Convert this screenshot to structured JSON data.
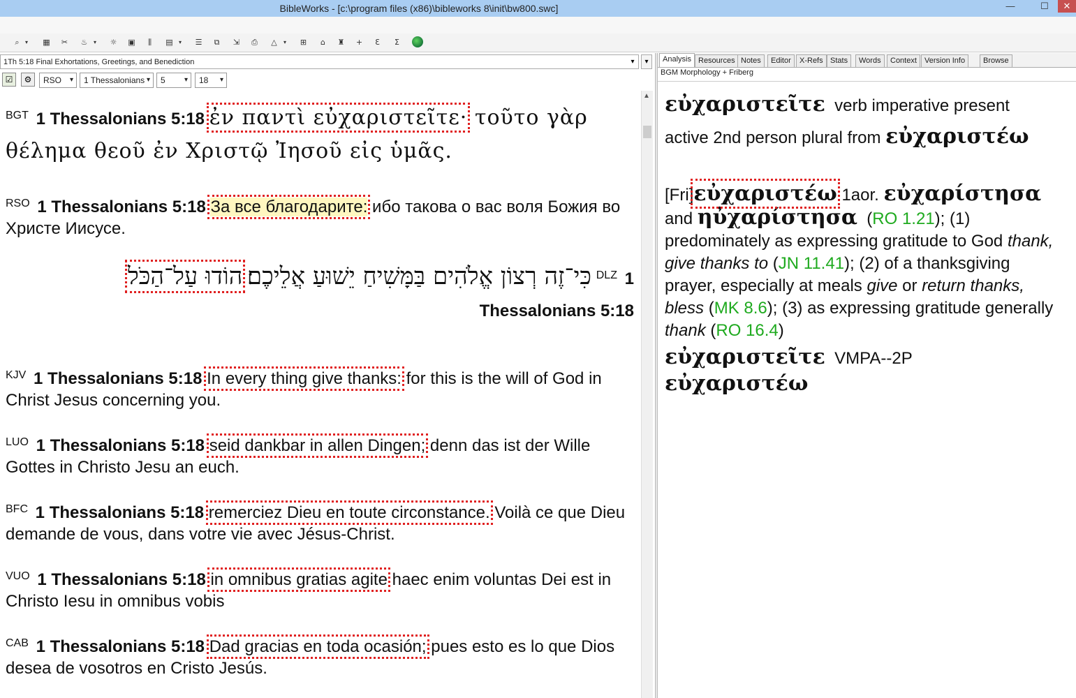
{
  "window": {
    "title": "BibleWorks - [c:\\program files (x86)\\bibleworks 8\\init\\bw800.swc]",
    "minimize": "—",
    "maximize": "☐",
    "close": "✕"
  },
  "toolbar": {
    "icons": [
      "search-icon",
      "search-options-icon",
      "bookmark-icon",
      "tools-icon",
      "lexicon-icon",
      "notes-icon",
      "window-icon",
      "parallel-icon",
      "grid-icon",
      "list-icon",
      "copy-icon",
      "export-icon",
      "print-icon",
      "highlight-icon",
      "layout-icon",
      "form-icon",
      "sort-icon",
      "plus-icon",
      "version-icon",
      "word-icon",
      "globe-icon"
    ]
  },
  "left": {
    "passage": "1Th 5:18 Final Exhortations, Greetings, and Benediction",
    "version_select": "RSO",
    "book_select": "1 Thessalonians",
    "chapter_select": "5",
    "verse_select": "18",
    "verses": [
      {
        "label": "BGT",
        "ref": "1 Thessalonians 5:18",
        "highlight": "ἐν παντὶ εὐχαριστεῖτε·",
        "rest": " τοῦτο γὰρ θέλημα θεοῦ ἐν Χριστῷ Ἰησοῦ εἰς ὑμᾶς."
      },
      {
        "label": "RSO",
        "ref": "1 Thessalonians 5:18",
        "highlight": "За все благодарите:",
        "rest": " ибо такова о вас воля Божия во Христе Иисусе."
      },
      {
        "label": "DLZ",
        "ref": "1 Thessalonians 5:18",
        "highlight": "הוֹדוּ עַל־הַכֹּל",
        "rest": " כִּי־זֶה רְצוֹן אֱלֹהִים בַּמָּשִׁיחַ יֵשׁוּעַ אֲלֵיכֶם׃"
      },
      {
        "label": "KJV",
        "ref": "1 Thessalonians 5:18",
        "highlight": "In every thing give thanks:",
        "rest": " for this is the will of God in Christ Jesus concerning you."
      },
      {
        "label": "LUO",
        "ref": "1 Thessalonians 5:18",
        "highlight": "seid dankbar in allen Dingen;",
        "rest": " denn das ist der Wille Gottes in Christo Jesu an euch."
      },
      {
        "label": "BFC",
        "ref": "1 Thessalonians 5:18",
        "highlight": "remerciez Dieu en toute circonstance.",
        "rest": " Voilà ce que Dieu demande de vous, dans votre vie avec Jésus-Christ."
      },
      {
        "label": "VUO",
        "ref": "1 Thessalonians 5:18",
        "highlight": "in omnibus gratias agite",
        "rest": " haec enim voluntas Dei est in Christo Iesu in omnibus vobis"
      },
      {
        "label": "CAB",
        "ref": "1 Thessalonians 5:18",
        "highlight": "Dad gracias en toda ocasión;",
        "rest": " pues esto es lo que Dios desea de vosotros en Cristo Jesús."
      }
    ]
  },
  "right": {
    "tabs": [
      "Analysis",
      "Resources",
      "Notes",
      "Editor",
      "X-Refs",
      "Stats",
      "Words",
      "Context",
      "Version Info",
      "Browse"
    ],
    "active_tab": "Analysis",
    "subheader": "BGM Morphology + Friberg",
    "analysis": {
      "word": "εὐχαριστεῖτε",
      "parse": "verb imperative present active 2nd person plural from",
      "lemma": "εὐχαριστέω",
      "fri_label": "[Fri]",
      "fri_word": "εὐχαριστέω",
      "aor_label": "1aor.",
      "aor1": "εὐχαρίστησα",
      "and": "and",
      "aor2": "ηὐχαρίστησα",
      "ref1": "RO 1.21",
      "def1a": "; (1) predominately as expressing gratitude to God",
      "def1b": "thank, give thanks to",
      "ref2": "JN 11.41",
      "def2a": "; (2) of a thanksgiving prayer, especially at meals",
      "def2b": "give",
      "def2c": "or",
      "def2d": "return thanks, bless",
      "ref3": "MK 8.6",
      "def3a": "; (3) as expressing gratitude generally",
      "def3b": "thank",
      "ref4": "RO 16.4",
      "code_word": "εὐχαριστεῖτε",
      "code": "VMPA--2P",
      "code_lemma": "εὐχαριστέω"
    }
  },
  "colors": {
    "titlebar": "#a9cdf2",
    "highlight_border": "#e02020",
    "link_green": "#1faa1f",
    "rso_bg": "#fff7c0"
  }
}
